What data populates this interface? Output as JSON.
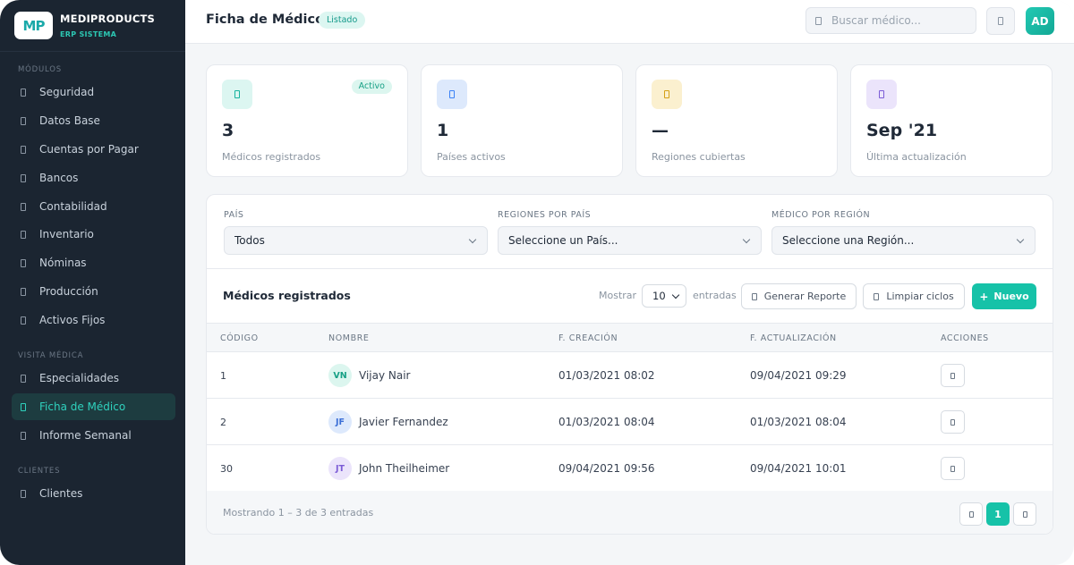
{
  "brand": {
    "logo": "MP",
    "name": "MEDIPRODUCTS",
    "subtitle": "ERP SISTEMA"
  },
  "sidebar": {
    "sections": [
      {
        "title": "MÓDULOS",
        "items": [
          "Seguridad",
          "Datos Base",
          "Cuentas por Pagar",
          "Bancos",
          "Contabilidad",
          "Inventario",
          "Nóminas",
          "Producción",
          "Activos Fijos"
        ]
      },
      {
        "title": "VISITA MÉDICA",
        "items": [
          "Especialidades",
          "Ficha de Médico",
          "Informe Semanal"
        ]
      },
      {
        "title": "CLIENTES",
        "items": [
          "Clientes"
        ]
      }
    ],
    "active_item": "Ficha de Médico"
  },
  "topbar": {
    "title": "Ficha de Médico",
    "badge": "Listado",
    "search_placeholder": "Buscar médico...",
    "user_initials": "AD"
  },
  "stats": [
    {
      "value": "3",
      "label": "Médicos registrados",
      "badge": "Activo",
      "icon": "doctor-icon",
      "color": "#16b39e"
    },
    {
      "value": "1",
      "label": "Países activos",
      "icon": "globe-icon",
      "color": "#3b82f6"
    },
    {
      "value": "—",
      "label": "Regiones cubiertas",
      "icon": "map-icon",
      "color": "#d4a017"
    },
    {
      "value": "Sep '21",
      "label": "Última actualización",
      "icon": "calendar-icon",
      "color": "#7c5cd6"
    }
  ],
  "filters": [
    {
      "label": "PAÍS",
      "value": "Todos"
    },
    {
      "label": "REGIONES POR PAÍS",
      "value": "Seleccione un País..."
    },
    {
      "label": "MÉDICO POR REGIÓN",
      "value": "Seleccione una Región..."
    }
  ],
  "table": {
    "title": "Médicos registrados",
    "show_label": "Mostrar",
    "page_size": "10",
    "entries_label": "entradas",
    "report_button": "Generar Reporte",
    "clear_button": "Limpiar ciclos",
    "new_button": "Nuevo",
    "columns": [
      "CÓDIGO",
      "NOMBRE",
      "F. CREACIÓN",
      "F. ACTUALIZACIÓN",
      "ACCIONES"
    ],
    "rows": [
      {
        "code": "1",
        "initials": "VN",
        "name": "Vijay Nair",
        "created": "01/03/2021 08:02",
        "updated": "09/04/2021 09:29"
      },
      {
        "code": "2",
        "initials": "JF",
        "name": "Javier Fernandez",
        "created": "01/03/2021 08:04",
        "updated": "01/03/2021 08:04"
      },
      {
        "code": "30",
        "initials": "JT",
        "name": "John Theilheimer",
        "created": "09/04/2021 09:56",
        "updated": "09/04/2021 10:01"
      }
    ],
    "footer_text": "Mostrando 1 – 3 de 3 entradas",
    "current_page": "1"
  }
}
